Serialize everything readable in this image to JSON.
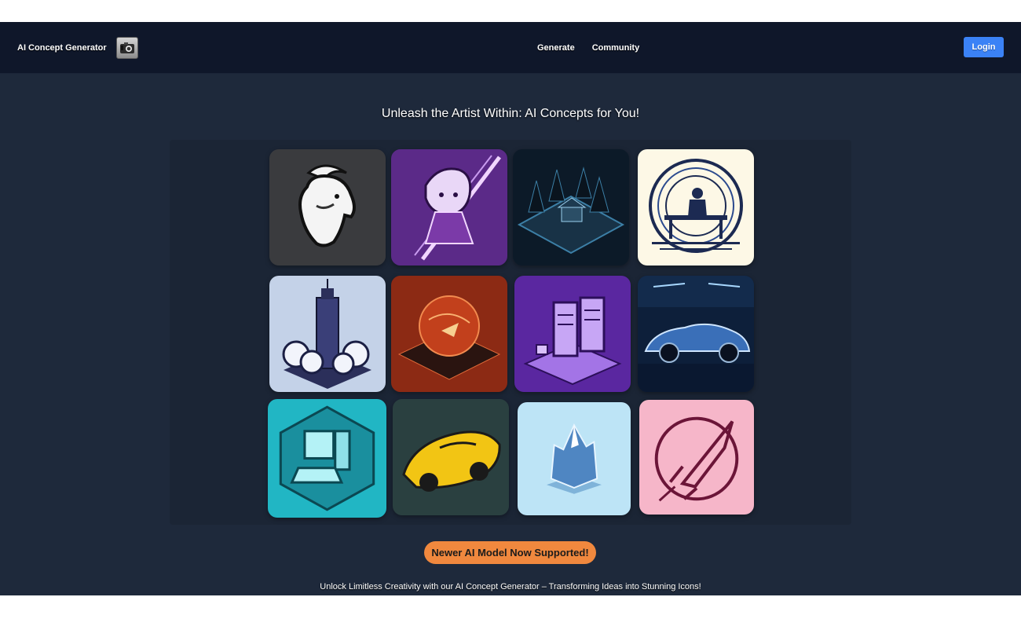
{
  "header": {
    "brand": "AI Concept Generator",
    "nav": [
      "Generate",
      "Community"
    ],
    "login": "Login"
  },
  "hero": {
    "title": "Unleash the Artist Within: AI Concepts for You!"
  },
  "gallery": {
    "items": [
      {
        "name": "white-goat-icon",
        "bg": "#3a3b3e"
      },
      {
        "name": "anime-swordsman-icon",
        "bg": "#5b2a88"
      },
      {
        "name": "dark-forest-cabin-icon",
        "bg": "#0c1a28"
      },
      {
        "name": "person-on-bench-icon",
        "bg": "#fdf8e6"
      },
      {
        "name": "cloud-skyscraper-icon",
        "bg": "#c4d2e8"
      },
      {
        "name": "red-planet-platform-icon",
        "bg": "#8c2a14"
      },
      {
        "name": "purple-server-rack-icon",
        "bg": "#5a27a0"
      },
      {
        "name": "blue-sports-car-icon",
        "bg": "#0d1f3a"
      },
      {
        "name": "teal-computer-icon",
        "bg": "#21b6c4"
      },
      {
        "name": "yellow-race-car-icon",
        "bg": "#2a4040"
      },
      {
        "name": "ice-mountain-icon",
        "bg": "#bde4f6"
      },
      {
        "name": "rocket-icon",
        "bg": "#f6b6c9"
      }
    ]
  },
  "cta": {
    "label": "Newer AI Model Now Supported!"
  },
  "footer": {
    "tagline": "Unlock Limitless Creativity with our AI Concept Generator – Transforming Ideas into Stunning Icons!"
  },
  "colors": {
    "navbar": "#0f172a",
    "page": "#1e293b",
    "login": "#3b82f6",
    "cta": "#f0883e"
  }
}
